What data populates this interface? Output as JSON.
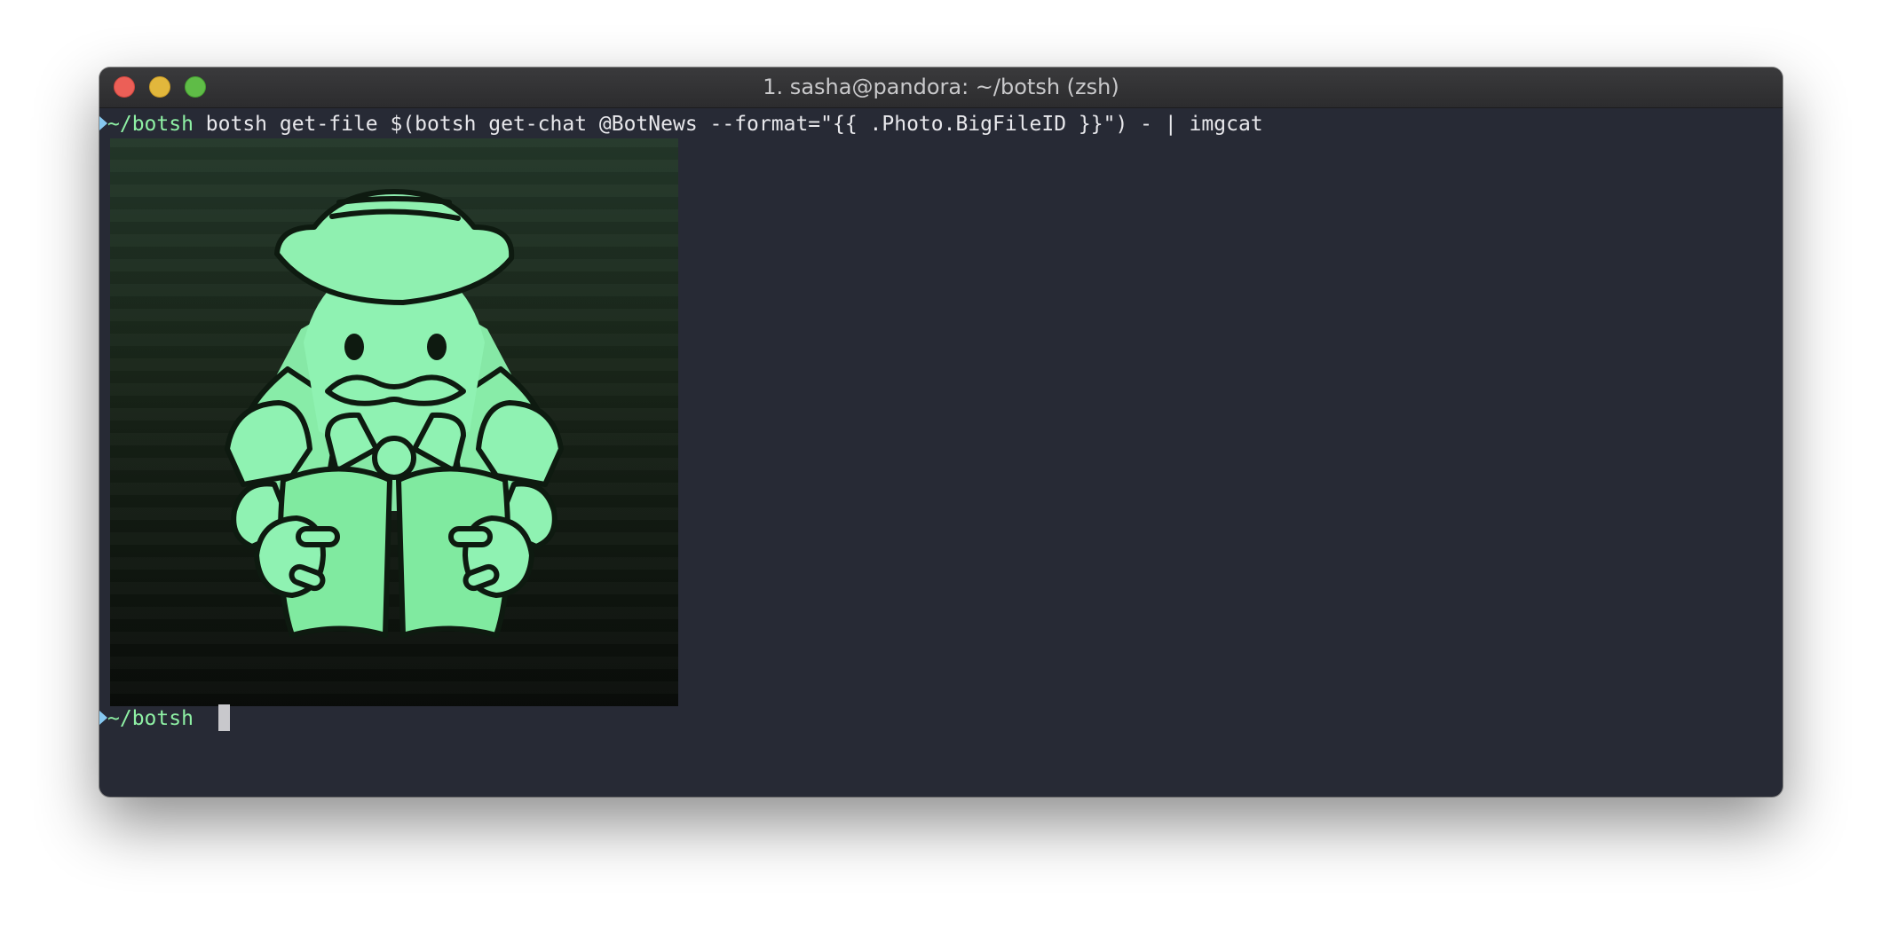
{
  "window": {
    "title": "1. sasha@pandora: ~/botsh (zsh)"
  },
  "terminal": {
    "lines": [
      {
        "cwd": "~/botsh",
        "command": " botsh get-file $(botsh get-chat @BotNews --format=\"{{ .Photo.BigFileID }}\") - | imgcat"
      },
      {
        "cwd": "~/botsh",
        "command": " "
      }
    ],
    "image_output": {
      "icon": "bot-news-mascot-icon"
    }
  },
  "colors": {
    "terminal_background": "#272a35",
    "prompt_arrow": "#86c8f0",
    "cwd": "#8ef0a4",
    "mascot_green": "#8ff0b0"
  }
}
